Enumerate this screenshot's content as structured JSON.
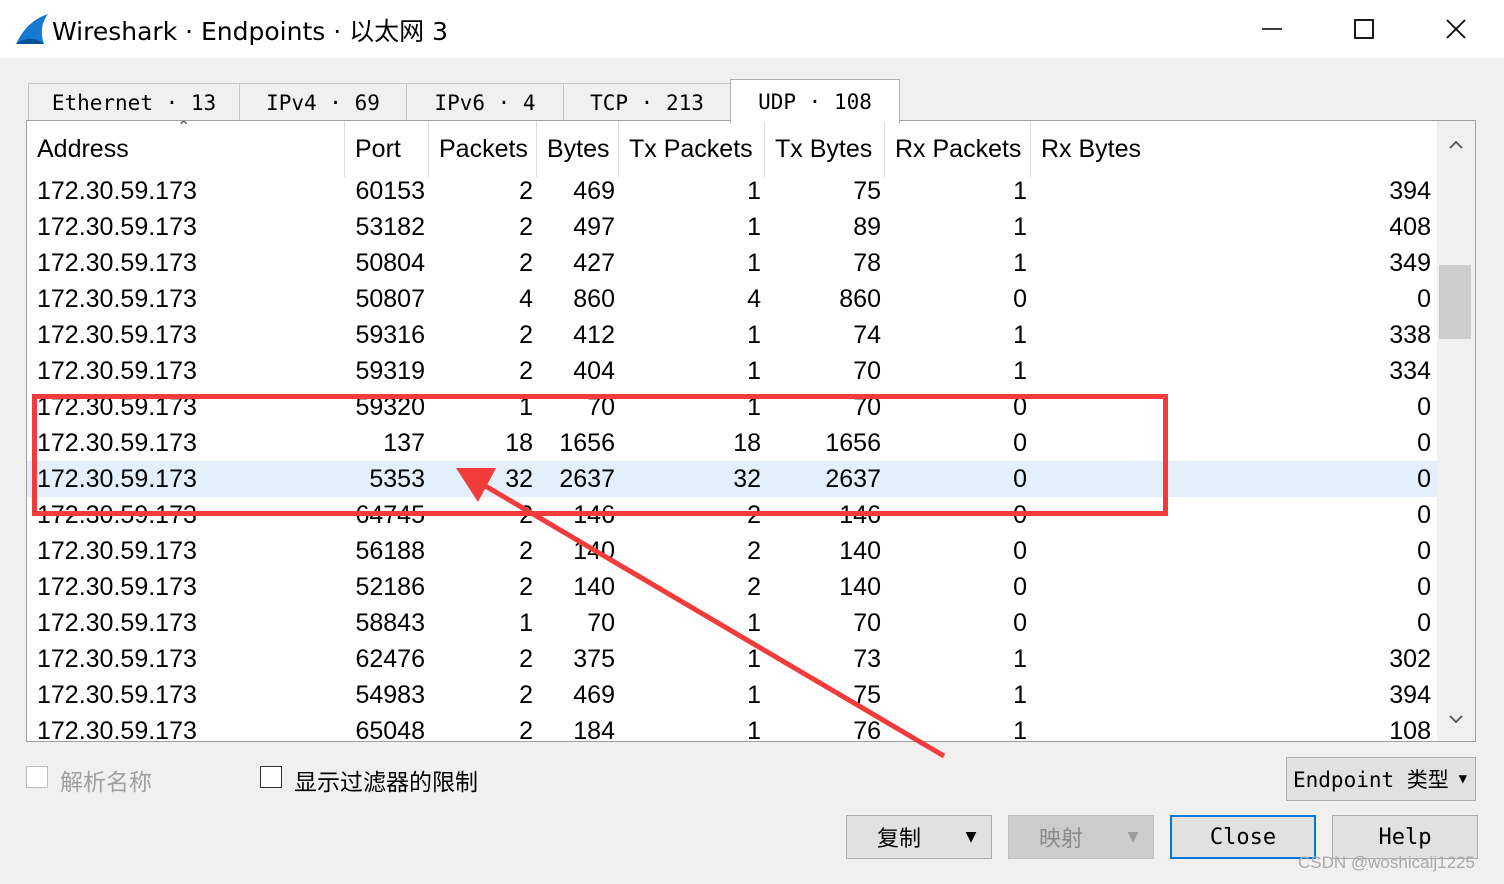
{
  "window": {
    "title": "Wireshark · Endpoints · 以太网 3"
  },
  "tabs": [
    {
      "label": "Ethernet · 13"
    },
    {
      "label": "IPv4 · 69"
    },
    {
      "label": "IPv6 · 4"
    },
    {
      "label": "TCP · 213"
    },
    {
      "label": "UDP · 108",
      "active": true
    }
  ],
  "table": {
    "columns": [
      "Address",
      "Port",
      "Packets",
      "Bytes",
      "Tx Packets",
      "Tx Bytes",
      "Rx Packets",
      "Rx Bytes"
    ],
    "sort_column": "Address",
    "selected_row_index": 8,
    "rows": [
      [
        "172.30.59.173",
        "60153",
        "2",
        "469",
        "1",
        "75",
        "1",
        "394"
      ],
      [
        "172.30.59.173",
        "53182",
        "2",
        "497",
        "1",
        "89",
        "1",
        "408"
      ],
      [
        "172.30.59.173",
        "50804",
        "2",
        "427",
        "1",
        "78",
        "1",
        "349"
      ],
      [
        "172.30.59.173",
        "50807",
        "4",
        "860",
        "4",
        "860",
        "0",
        "0"
      ],
      [
        "172.30.59.173",
        "59316",
        "2",
        "412",
        "1",
        "74",
        "1",
        "338"
      ],
      [
        "172.30.59.173",
        "59319",
        "2",
        "404",
        "1",
        "70",
        "1",
        "334"
      ],
      [
        "172.30.59.173",
        "59320",
        "1",
        "70",
        "1",
        "70",
        "0",
        "0"
      ],
      [
        "172.30.59.173",
        "137",
        "18",
        "1656",
        "18",
        "1656",
        "0",
        "0"
      ],
      [
        "172.30.59.173",
        "5353",
        "32",
        "2637",
        "32",
        "2637",
        "0",
        "0"
      ],
      [
        "172.30.59.173",
        "64745",
        "2",
        "146",
        "2",
        "146",
        "0",
        "0"
      ],
      [
        "172.30.59.173",
        "56188",
        "2",
        "140",
        "2",
        "140",
        "0",
        "0"
      ],
      [
        "172.30.59.173",
        "52186",
        "2",
        "140",
        "2",
        "140",
        "0",
        "0"
      ],
      [
        "172.30.59.173",
        "58843",
        "1",
        "70",
        "1",
        "70",
        "0",
        "0"
      ],
      [
        "172.30.59.173",
        "62476",
        "2",
        "375",
        "1",
        "73",
        "1",
        "302"
      ],
      [
        "172.30.59.173",
        "54983",
        "2",
        "469",
        "1",
        "75",
        "1",
        "394"
      ],
      [
        "172.30.59.173",
        "65048",
        "2",
        "184",
        "1",
        "76",
        "1",
        "108"
      ]
    ]
  },
  "options": {
    "resolve_names_label": "解析名称",
    "resolve_names_checked": false,
    "resolve_names_enabled": false,
    "limit_filter_label": "显示过滤器的限制",
    "limit_filter_checked": false
  },
  "buttons": {
    "endpoint_type": "Endpoint 类型",
    "copy": "复制",
    "map": "映射",
    "close": "Close",
    "help": "Help"
  },
  "watermark": "CSDN @woshicaij1225",
  "colors": {
    "selected_row": "#e3f0fb",
    "annotation_red": "#f23c3c",
    "focus_blue": "#0078d7"
  }
}
